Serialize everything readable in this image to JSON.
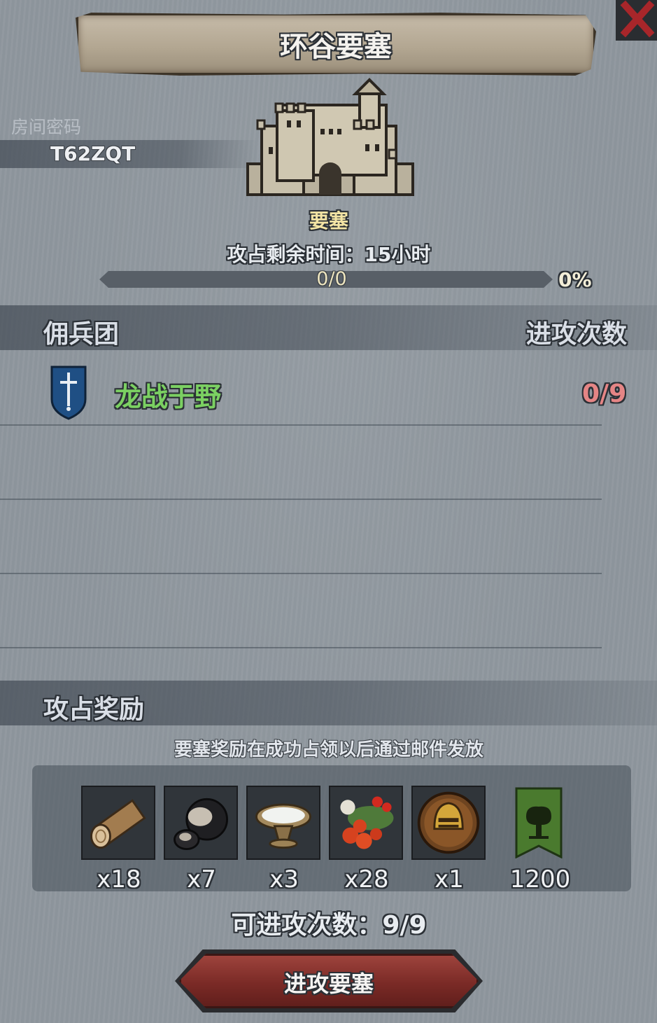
{
  "header": {
    "title": "环谷要塞"
  },
  "room": {
    "label": "房间密码",
    "code": "T62ZQT"
  },
  "fortress": {
    "type_label": "要塞",
    "timer_text": "攻占剩余时间：15小时",
    "progress_text": "0/0",
    "progress_percent_text": "0%",
    "progress_fraction": 0
  },
  "mercenaries": {
    "header_left": "佣兵团",
    "header_right": "进攻次数",
    "rows": [
      {
        "name": "龙战于野",
        "count": "0/9",
        "icon": "sword-shield-icon"
      }
    ]
  },
  "rewards": {
    "header": "攻占奖励",
    "note": "要塞奖励在成功占领以后通过邮件发放",
    "items": [
      {
        "icon": "wood-log-icon",
        "count": "x18"
      },
      {
        "icon": "truffle-icon",
        "count": "x7"
      },
      {
        "icon": "milk-bowl-icon",
        "count": "x3"
      },
      {
        "icon": "berries-icon",
        "count": "x28"
      },
      {
        "icon": "knight-helmet-coin-icon",
        "count": "x1"
      },
      {
        "icon": "guild-banner-icon",
        "count": "1200"
      }
    ]
  },
  "footer": {
    "attempts_text": "可进攻次数：9/9",
    "attack_button": "进攻要塞"
  },
  "colors": {
    "background": "#8f979e",
    "merc_name": "#7bd062",
    "merc_count": "#e58585",
    "fortress_label": "#f3e4a4",
    "button": "#7a2a26"
  }
}
